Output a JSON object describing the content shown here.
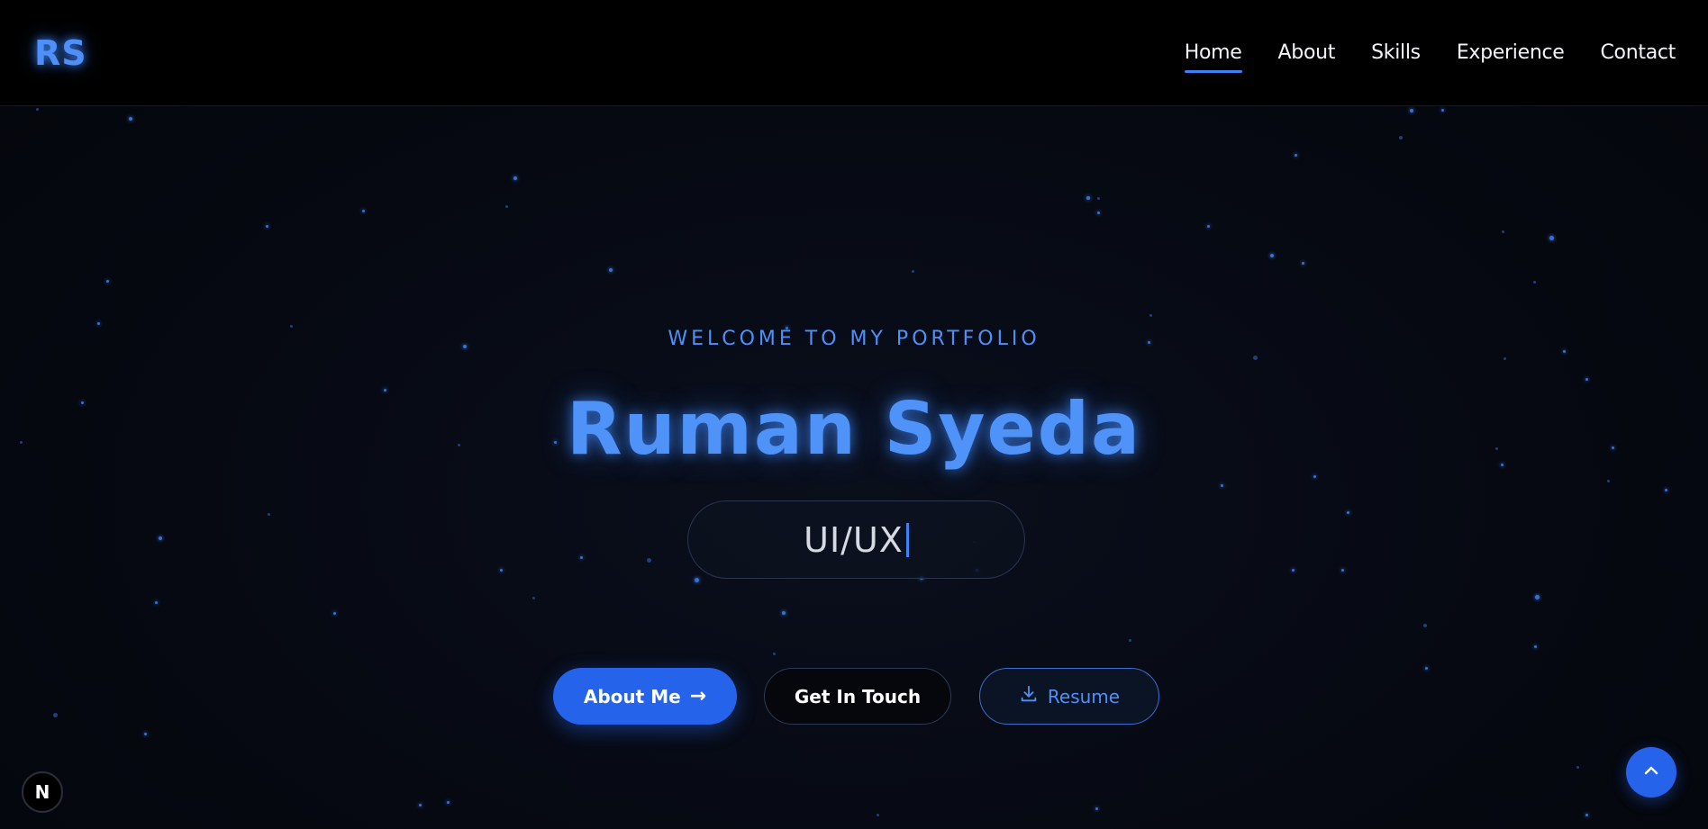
{
  "header": {
    "logo": "RS",
    "nav": [
      {
        "label": "Home",
        "active": true
      },
      {
        "label": "About",
        "active": false
      },
      {
        "label": "Skills",
        "active": false
      },
      {
        "label": "Experience",
        "active": false
      },
      {
        "label": "Contact",
        "active": false
      }
    ]
  },
  "hero": {
    "welcome": "WELCOME TO MY PORTFOLIO",
    "name": "Ruman Syeda",
    "typed_role": "UI/UX",
    "buttons": {
      "about": "About Me",
      "about_arrow": "→",
      "contact": "Get In Touch",
      "resume": "Resume"
    }
  },
  "floating": {
    "badge": "N",
    "scroll_top_icon": "chevron-up-icon",
    "download_icon": "download-icon"
  },
  "colors": {
    "accent": "#3b82f6",
    "primary_button": "#2563eb",
    "background": "#05070d"
  }
}
